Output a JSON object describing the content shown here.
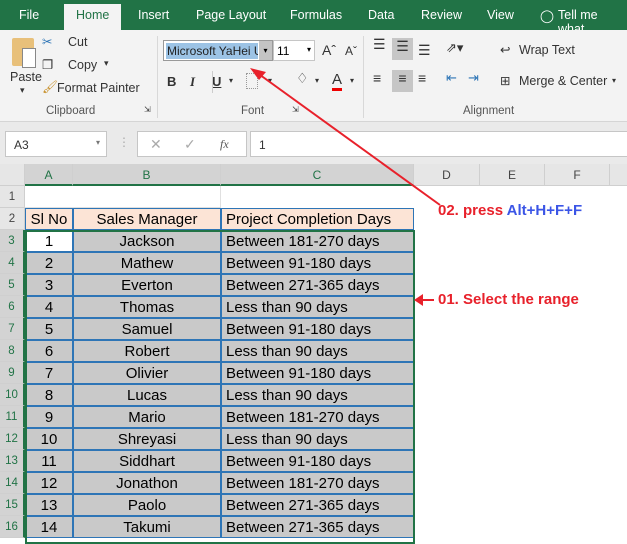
{
  "ribbon_tabs": [
    "File",
    "Home",
    "Insert",
    "Page Layout",
    "Formulas",
    "Data",
    "Review",
    "View",
    "Tell me what"
  ],
  "active_tab": "Home",
  "clipboard": {
    "paste": "Paste",
    "cut": "Cut",
    "copy": "Copy",
    "format_painter": "Format Painter",
    "label": "Clipboard"
  },
  "font": {
    "name": "Microsoft YaHei U",
    "size": "11",
    "bold": "B",
    "italic": "I",
    "underline": "U",
    "font_color_letter": "A",
    "label": "Font"
  },
  "alignment": {
    "wrap_text": "Wrap Text",
    "merge_center": "Merge & Center",
    "label": "Alignment"
  },
  "formula_bar": {
    "name_box": "A3",
    "fx": "fx",
    "value": "1"
  },
  "columns": [
    "A",
    "B",
    "C",
    "D",
    "E",
    "F"
  ],
  "rows": [
    "1",
    "2",
    "3",
    "4",
    "5",
    "6",
    "7",
    "8",
    "9",
    "10",
    "11",
    "12",
    "13",
    "14",
    "15",
    "16"
  ],
  "table": {
    "headers": [
      "Sl No",
      "Sales Manager",
      "Project Completion Days"
    ],
    "data": [
      [
        "1",
        "Jackson",
        "Between 181-270 days"
      ],
      [
        "2",
        "Mathew",
        "Between 91-180 days"
      ],
      [
        "3",
        "Everton",
        "Between 271-365 days"
      ],
      [
        "4",
        "Thomas",
        "Less than 90 days"
      ],
      [
        "5",
        "Samuel",
        "Between 91-180 days"
      ],
      [
        "6",
        "Robert",
        "Less than 90 days"
      ],
      [
        "7",
        "Olivier",
        "Between 91-180 days"
      ],
      [
        "8",
        "Lucas",
        "Less than 90 days"
      ],
      [
        "9",
        "Mario",
        "Between 181-270 days"
      ],
      [
        "10",
        "Shreyasi",
        "Less than 90 days"
      ],
      [
        "11",
        "Siddhart",
        "Between 91-180 days"
      ],
      [
        "12",
        "Jonathon",
        "Between 181-270 days"
      ],
      [
        "13",
        "Paolo",
        "Between 271-365 days"
      ],
      [
        "14",
        "Takumi",
        "Between 271-365 days"
      ]
    ]
  },
  "annotations": {
    "step1": "01. Select the range",
    "step2_prefix": "02. press ",
    "step2_keys": "Alt+H+F+F"
  },
  "colors": {
    "excel_green": "#217346",
    "annotation_red": "#e8212b",
    "keys_blue": "#3b55e6",
    "header_fill": "#fce4d6",
    "selection_fill": "#c9c9c9"
  }
}
